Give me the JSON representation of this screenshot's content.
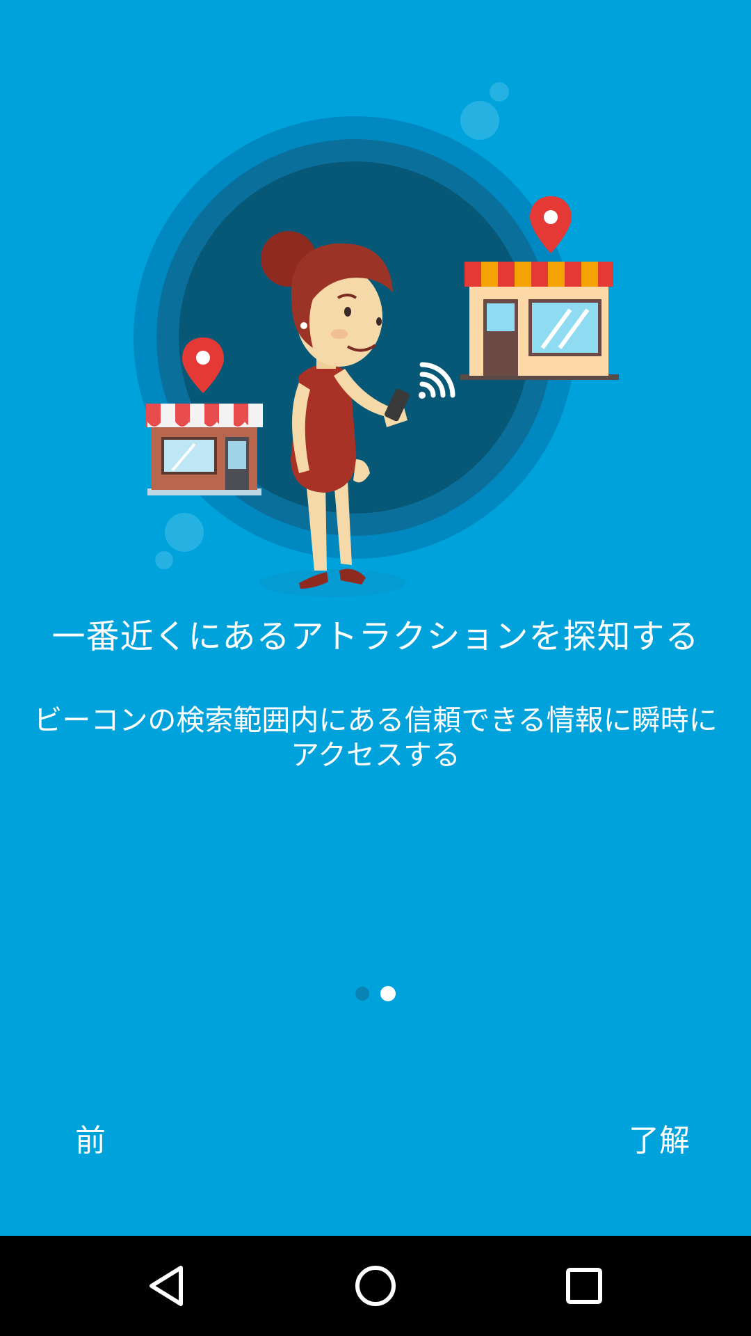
{
  "onboarding": {
    "title": "一番近くにあるアトラクションを探知する",
    "description": "ビーコンの検索範囲内にある信頼できる情報に瞬時にアクセスする",
    "page_indicator": {
      "total": 2,
      "current": 2
    },
    "prev_label": "前",
    "ok_label": "了解"
  },
  "illustration_icons": [
    "store-icon",
    "location-pin-icon",
    "woman-with-phone-icon",
    "beacon-signal-icon"
  ],
  "navbar": {
    "icons": [
      "back-icon",
      "home-icon",
      "recents-icon"
    ]
  },
  "colors": {
    "background": "#00A2DC",
    "navbar": "#000000",
    "text": "#FFFFFF",
    "dot_inactive": "#0A82B3",
    "dot_active": "#FFFFFF",
    "pin": "#E53935"
  }
}
